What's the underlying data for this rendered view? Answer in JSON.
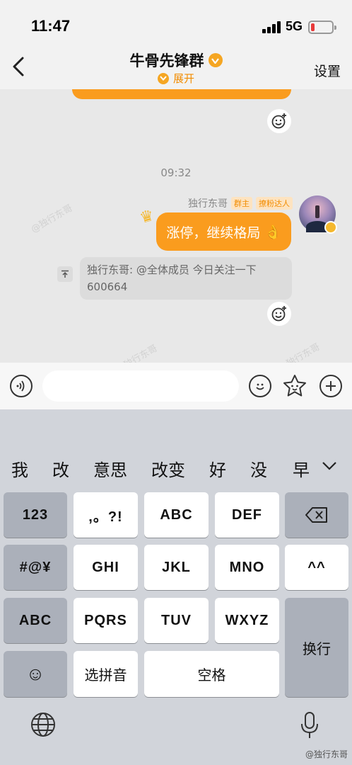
{
  "status_bar": {
    "time": "11:47",
    "network": "5G"
  },
  "nav": {
    "title": "牛骨先锋群",
    "expand_label": "展开",
    "settings_label": "设置"
  },
  "chat": {
    "timestamp": "09:32",
    "message": {
      "sender": "独行东哥",
      "tags": [
        "群主",
        "撩粉达人"
      ],
      "text": "涨停，继续格局",
      "emoji": "👌"
    },
    "notice": "独行东哥: @全体成员 今日关注一下600664",
    "watermark": "@独行东哥"
  },
  "input": {
    "placeholder": ""
  },
  "keyboard": {
    "candidates": [
      "我",
      "改",
      "意思",
      "改变",
      "好",
      "没",
      "早"
    ],
    "rows": [
      [
        "123",
        ",。?!",
        "ABC",
        "DEF",
        "⌫"
      ],
      [
        "#@¥",
        "GHI",
        "JKL",
        "MNO",
        "^^"
      ],
      [
        "ABC",
        "PQRS",
        "TUV",
        "WXYZ",
        "换行"
      ],
      [
        "☺",
        "选拼音",
        "空格"
      ]
    ]
  },
  "footer": {
    "source": "@独行东哥"
  },
  "colors": {
    "accent": "#fa9c1e",
    "keyboard_bg": "#d1d4da",
    "key_dark": "#abb0ba"
  }
}
